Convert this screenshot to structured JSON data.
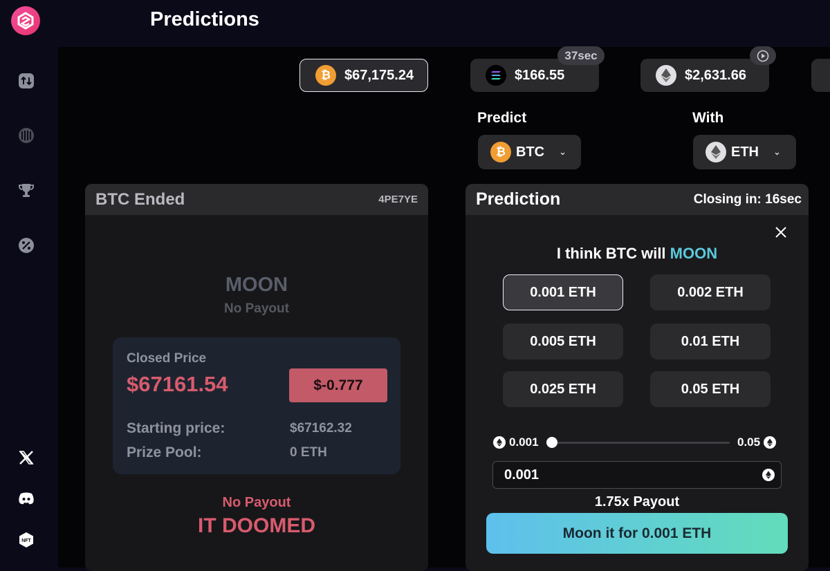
{
  "header": {
    "title": "Predictions"
  },
  "tickers": [
    {
      "icon": "bitcoin-icon",
      "price": "$67,175.24"
    },
    {
      "icon": "solana-icon",
      "price": "$166.55",
      "badge": "37sec"
    },
    {
      "icon": "ethereum-icon",
      "price": "$2,631.66"
    }
  ],
  "selectors": {
    "predict_label": "Predict",
    "predict_value": "BTC",
    "with_label": "With",
    "with_value": "ETH"
  },
  "ended_card": {
    "title": "BTC Ended",
    "round_id": "4PE7YE",
    "direction": "MOON",
    "direction_status": "No Payout",
    "closed_price_label": "Closed Price",
    "closed_price": "$67161.54",
    "delta": "$-0.777",
    "starting_price_label": "Starting price:",
    "starting_price": "$67162.32",
    "prize_pool_label": "Prize Pool:",
    "prize_pool": "0 ETH",
    "result_status": "No Payout",
    "result": "IT DOOMED"
  },
  "prediction_card": {
    "title": "Prediction",
    "closing": "Closing in: 16sec",
    "statement_prefix": "I think BTC will",
    "statement_direction": "MOON",
    "amounts": [
      "0.001 ETH",
      "0.002 ETH",
      "0.005 ETH",
      "0.01 ETH",
      "0.025 ETH",
      "0.05 ETH"
    ],
    "selected_amount_index": 0,
    "slider_min": "0.001",
    "slider_max": "0.05",
    "slider_fraction": 0,
    "input_value": "0.001",
    "payout": "1.75x Payout",
    "submit_label": "Moon it for 0.001 ETH"
  },
  "colors": {
    "accent_moon": "#5cc8dc",
    "doom": "#d85b6d",
    "brand": "#f24d9c"
  }
}
